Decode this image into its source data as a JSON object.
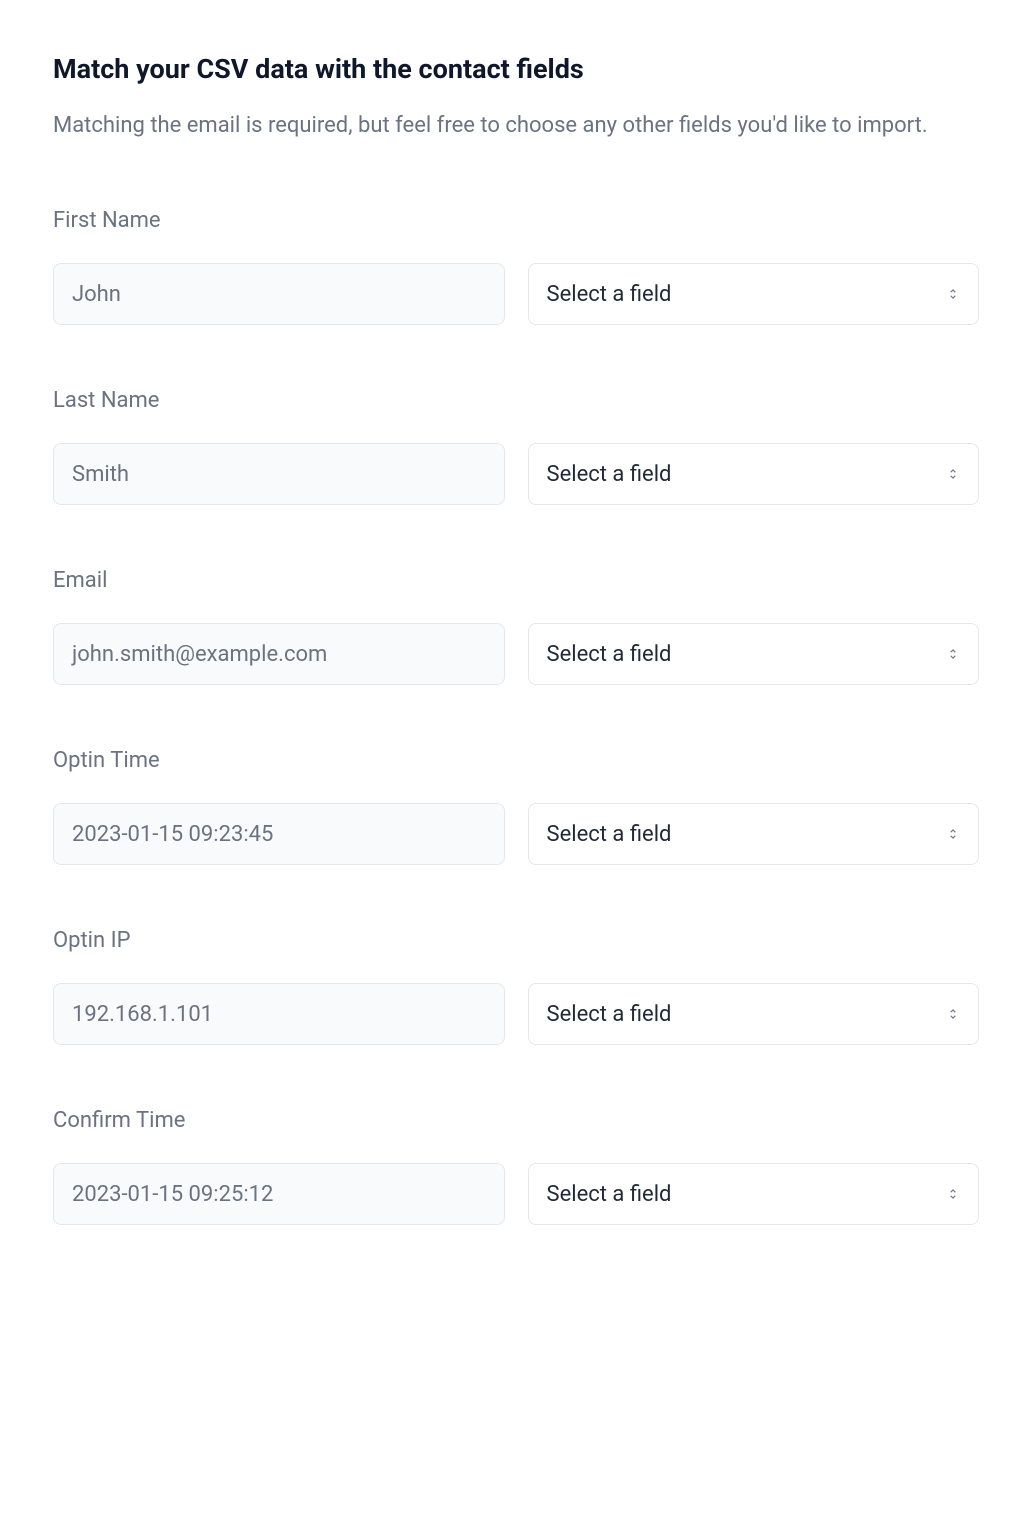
{
  "header": {
    "title": "Match your CSV data with the contact fields",
    "subtitle": "Matching the email is required, but feel free to choose any other fields you'd like to import."
  },
  "select_placeholder": "Select a field",
  "fields": [
    {
      "label": "First Name",
      "sample": "John"
    },
    {
      "label": "Last Name",
      "sample": "Smith"
    },
    {
      "label": "Email",
      "sample": "john.smith@example.com"
    },
    {
      "label": "Optin Time",
      "sample": "2023-01-15 09:23:45"
    },
    {
      "label": "Optin IP",
      "sample": "192.168.1.101"
    },
    {
      "label": "Confirm Time",
      "sample": "2023-01-15 09:25:12"
    }
  ]
}
